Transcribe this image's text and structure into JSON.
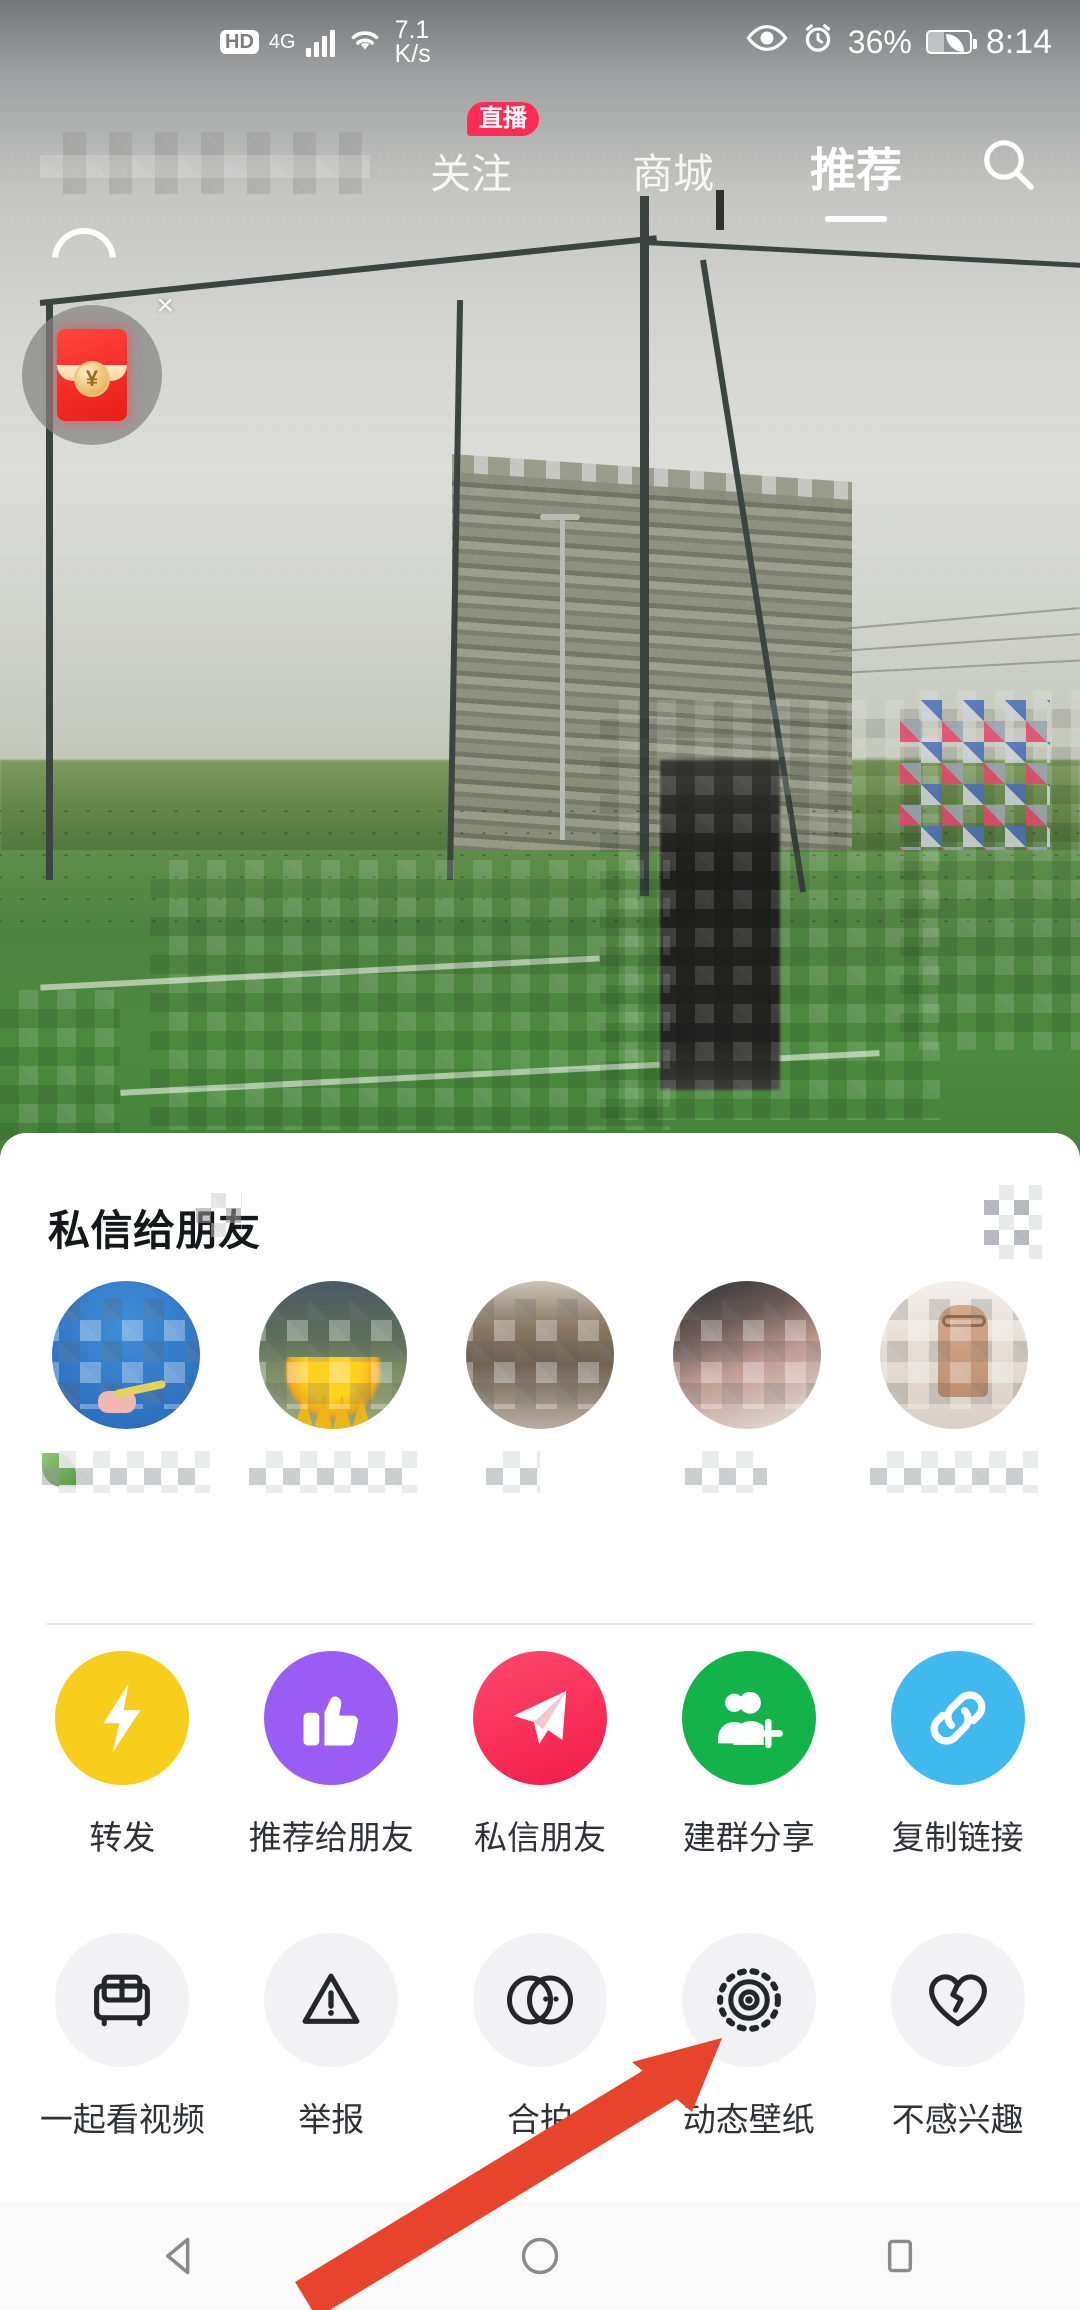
{
  "status_bar": {
    "hd_label": "HD",
    "network_type": "4G",
    "net_speed_value": "7.1",
    "net_speed_unit": "K/s",
    "eye_icon": "eye-comfort-icon",
    "alarm_icon": "alarm-clock-icon",
    "battery_percent": "36%",
    "battery_icon": "battery-power-saving-icon",
    "time": "8:14"
  },
  "top_nav": {
    "blurred_label": "",
    "tabs": [
      {
        "label": "关注",
        "active": false,
        "badge": "直播"
      },
      {
        "label": "商城",
        "active": false,
        "badge": ""
      },
      {
        "label": "推荐",
        "active": true,
        "badge": ""
      }
    ],
    "search_icon": "search-icon"
  },
  "floating_promo": {
    "icon": "red-packet-icon",
    "currency_symbol": "¥",
    "close_label": "×"
  },
  "share_sheet": {
    "title": "私信给朋友",
    "friends": [
      {
        "name": "",
        "avatar": "friend-avatar-1"
      },
      {
        "name": "",
        "avatar": "friend-avatar-2"
      },
      {
        "name": "",
        "avatar": "friend-avatar-3"
      },
      {
        "name": "",
        "avatar": "friend-avatar-4"
      },
      {
        "name": "",
        "avatar": "friend-avatar-5"
      }
    ],
    "actions_row1": [
      {
        "label": "转发",
        "icon": "lightning-bolt-icon",
        "color": "#F7CE1C"
      },
      {
        "label": "推荐给朋友",
        "icon": "thumbs-up-icon",
        "color": "#9B5CF6"
      },
      {
        "label": "私信朋友",
        "icon": "paper-plane-icon",
        "color": "#F9305A"
      },
      {
        "label": "建群分享",
        "icon": "add-user-group-icon",
        "color": "#12B449"
      },
      {
        "label": "复制链接",
        "icon": "link-chain-icon",
        "color": "#3FB9EE"
      }
    ],
    "actions_row2": [
      {
        "label": "一起看视频",
        "icon": "sofa-icon",
        "color": "#F2F2F4"
      },
      {
        "label": "举报",
        "icon": "warning-triangle-icon",
        "color": "#F2F2F4"
      },
      {
        "label": "合拍",
        "icon": "duet-circles-icon",
        "color": "#F2F2F4"
      },
      {
        "label": "动态壁纸",
        "icon": "live-wallpaper-icon",
        "color": "#F2F2F4"
      },
      {
        "label": "不感兴趣",
        "icon": "broken-heart-icon",
        "color": "#F2F2F4"
      }
    ]
  },
  "annotation": {
    "arrow_color": "#E8442C",
    "points_to": "动态壁纸"
  },
  "system_nav": {
    "back": "back-triangle-icon",
    "home": "home-circle-icon",
    "recents": "recents-square-icon"
  }
}
